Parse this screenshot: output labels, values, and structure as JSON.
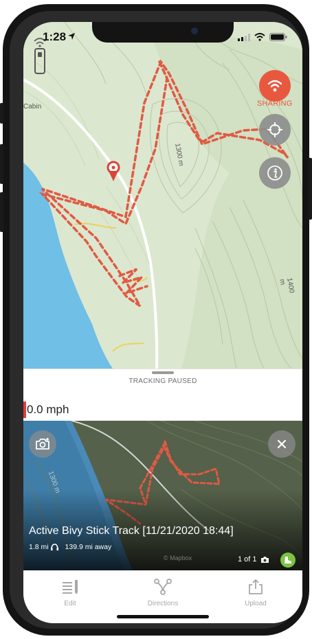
{
  "status_bar": {
    "time": "1:28"
  },
  "map": {
    "labels": {
      "cabin": "Cabin",
      "contour_1": "1300 m",
      "contour_2": "1400 m"
    },
    "buttons": {
      "sharing_label": "SHARING",
      "locate_icon": "crosshair-icon",
      "info_icon": "info-icon",
      "signal_icon": "signal-device-icon"
    }
  },
  "tracking": {
    "status_text": "TRACKING PAUSED"
  },
  "speed": {
    "value_text": "0.0 mph"
  },
  "track_card": {
    "title": "Active Bivy Stick Track [11/21/2020 18:44]",
    "distance": "1.8 mi",
    "away": "139.9 mi away",
    "pager": "1 of 1",
    "contour_label": "1300 m",
    "credit": "© Mapbox"
  },
  "toolbar": {
    "items": [
      {
        "label": "Edit",
        "icon": "edit-list-icon"
      },
      {
        "label": "Directions",
        "icon": "directions-route-icon"
      },
      {
        "label": "Upload",
        "icon": "upload-icon"
      }
    ]
  },
  "colors": {
    "track": "#e05a44",
    "sharing": "#e8583f",
    "water": "#6fbfe6",
    "map_land": "#dfe8d2",
    "success": "#7dc242"
  }
}
